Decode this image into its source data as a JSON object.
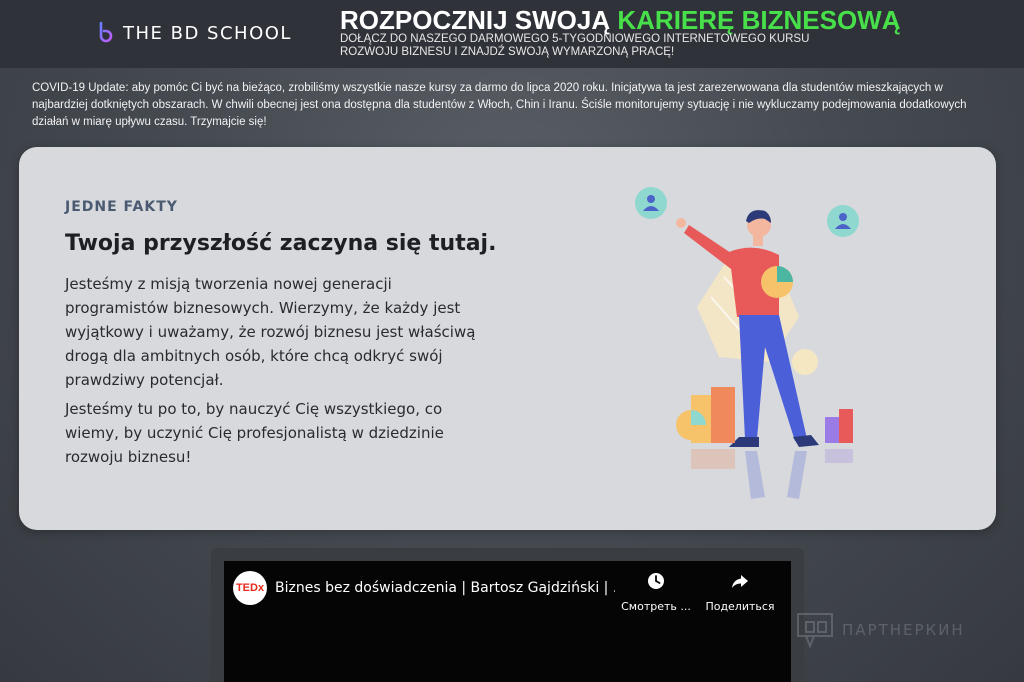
{
  "header": {
    "logo_text": "THE BD SCHOOL",
    "headline_main": "ROZPOCZNIJ SWOJĄ",
    "headline_accent": "KARIERĘ BIZNESOWĄ",
    "subline": "DOŁĄCZ DO NASZEGO DARMOWEGO 5-TYGODNIOWEGO INTERNETOWEGO KURSU ROZWOJU BIZNESU I ZNAJDŹ SWOJĄ WYMARZONĄ PRACĘ!"
  },
  "notice": {
    "text": "COVID-19 Update: aby pomóc Ci być na bieżąco, zrobiliśmy wszystkie nasze kursy za darmo do lipca 2020 roku. Inicjatywa ta jest zarezerwowana dla studentów mieszkających w najbardziej dotkniętych obszarach. W chwili obecnej jest ona dostępna dla studentów z Włoch, Chin i Iranu. Ściśle monitorujemy sytuację i nie wykluczamy podejmowania dodatkowych działań w miarę upływu czasu. Trzymajcie się!"
  },
  "facts": {
    "eyebrow": "JEDNE FAKTY",
    "title": "Twoja przyszłość zaczyna się tutaj.",
    "paragraph1": "Jesteśmy z misją tworzenia nowej generacji programistów biznesowych. Wierzymy, że każdy jest wyjątkowy i uważamy, że rozwój biznesu jest właściwą drogą dla ambitnych osób, które chcą odkryć swój prawdziwy potencjał.",
    "paragraph2": "Jesteśmy tu po to, by nauczyć Cię wszystkiego, co wiemy, by uczynić Cię profesjonalistą w dziedzinie rozwoju biznesu!"
  },
  "video": {
    "channel_logo": "TEDx",
    "title": "Biznes bez doświadczenia | Bartosz Gajdziński | ...",
    "watch_label": "Смотреть ...",
    "share_label": "Поделиться"
  },
  "watermark": {
    "text": "ПАРТНЕРКИН"
  },
  "colors": {
    "accent_green": "#48e04a",
    "topbar": "#2f3238",
    "card_bg": "#d7d9dc",
    "eyebrow": "#4b5a72",
    "ted_red": "#e62b1e"
  },
  "icons": {
    "logo": "bd-school-logo-icon",
    "watch": "clock-icon",
    "share": "share-arrow-icon"
  }
}
